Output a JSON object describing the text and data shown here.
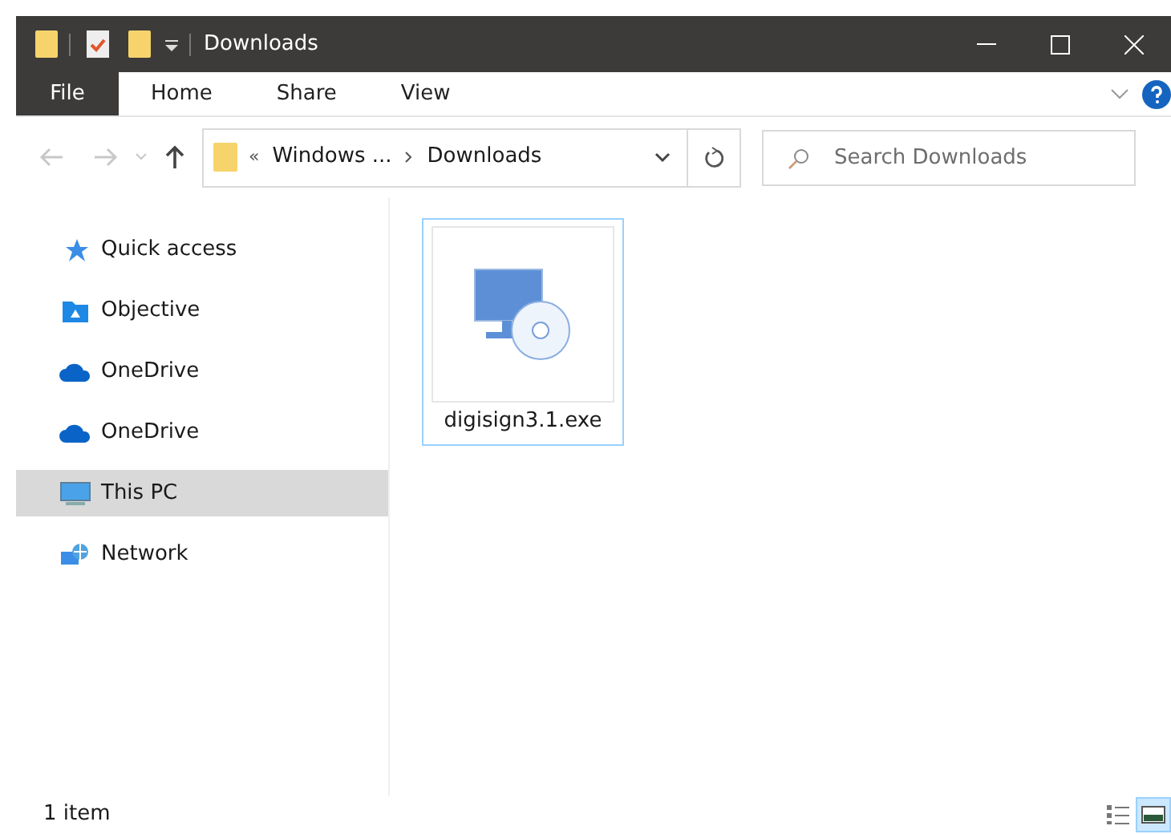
{
  "window": {
    "title": "Downloads"
  },
  "ribbon_tabs": [
    {
      "label": "File",
      "selected": true
    },
    {
      "label": "Home",
      "selected": false
    },
    {
      "label": "Share",
      "selected": false
    },
    {
      "label": "View",
      "selected": false
    }
  ],
  "address": {
    "overflow": "«",
    "segments": [
      "Windows ...",
      "Downloads"
    ]
  },
  "search": {
    "placeholder": "Search Downloads"
  },
  "sidebar": {
    "items": [
      {
        "label": "Quick access",
        "kind": "star",
        "selected": false
      },
      {
        "label": "Objective",
        "kind": "objective",
        "selected": false
      },
      {
        "label": "OneDrive",
        "kind": "cloud",
        "selected": false
      },
      {
        "label": "OneDrive",
        "kind": "cloud",
        "selected": false
      },
      {
        "label": "This PC",
        "kind": "pc",
        "selected": true
      },
      {
        "label": "Network",
        "kind": "network",
        "selected": false
      }
    ]
  },
  "files": [
    {
      "name": "digisign3.1.exe",
      "selected": true
    }
  ],
  "status_bar": {
    "count": "1 item",
    "views": [
      {
        "kind": "details",
        "selected": false
      },
      {
        "kind": "large",
        "selected": true
      }
    ]
  }
}
